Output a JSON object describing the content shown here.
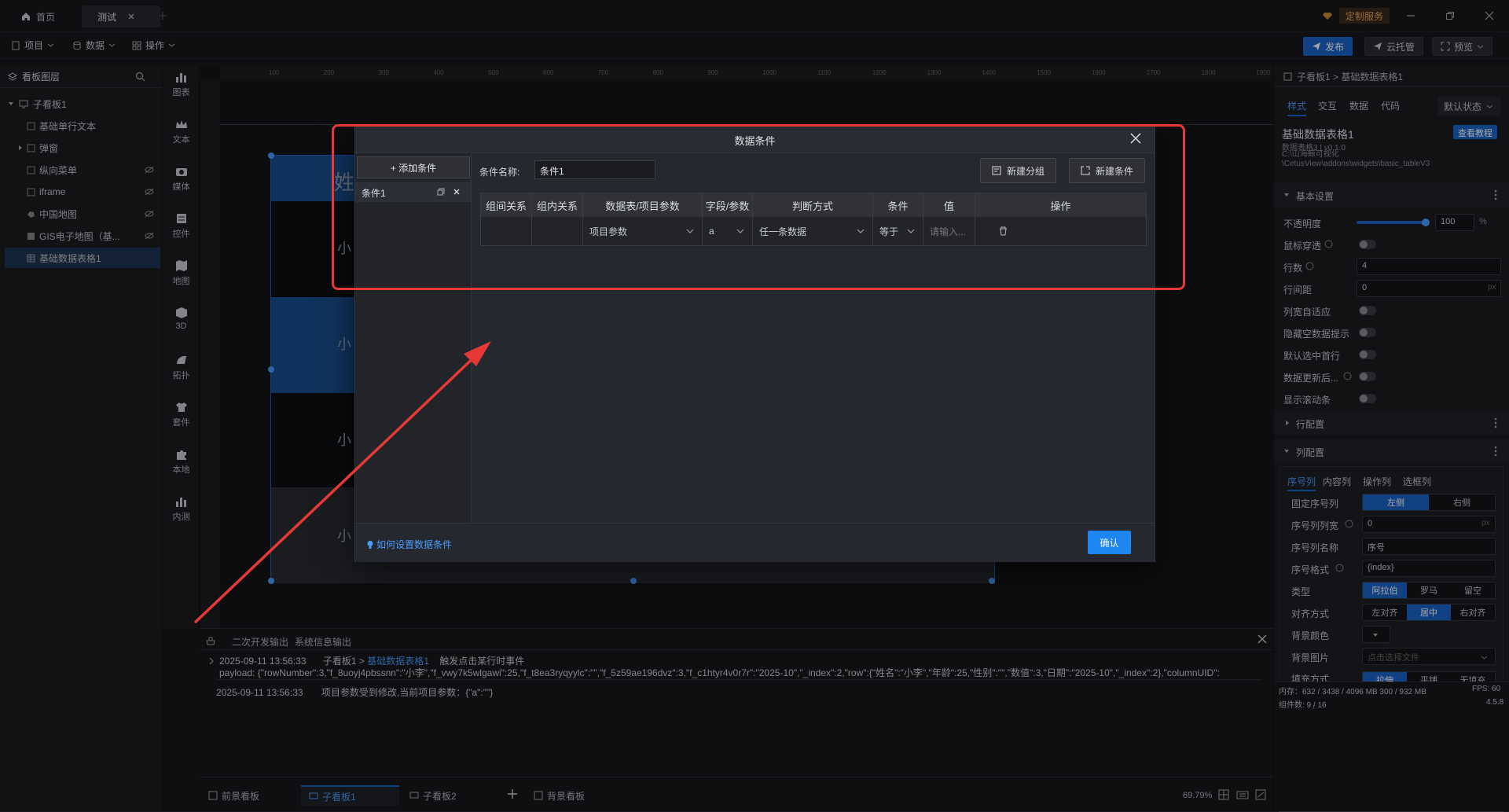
{
  "title_tabs": [
    {
      "label": "首页"
    },
    {
      "label": "测试"
    }
  ],
  "window": {
    "custom_service": "定制服务"
  },
  "menubar": {
    "project": "项目",
    "data": "数据",
    "operation": "操作",
    "publish": "发布",
    "cloud": "云托管",
    "preview": "预览"
  },
  "layers": {
    "header": "看板图层",
    "items": [
      {
        "label": "子看板1"
      },
      {
        "label": "基础单行文本"
      },
      {
        "label": "弹窗"
      },
      {
        "label": "纵向菜单"
      },
      {
        "label": "iframe"
      },
      {
        "label": "中国地图"
      },
      {
        "label": "GIS电子地图（基..."
      },
      {
        "label": "基础数据表格1"
      }
    ]
  },
  "tools": [
    {
      "label": "图表"
    },
    {
      "label": "文本"
    },
    {
      "label": "媒体"
    },
    {
      "label": "控件"
    },
    {
      "label": "地图"
    },
    {
      "label": "3D"
    },
    {
      "label": "拓扑"
    },
    {
      "label": "套件"
    },
    {
      "label": "本地"
    },
    {
      "label": "内测"
    }
  ],
  "ruler": {
    "ticks": [
      "100",
      "200",
      "300",
      "400",
      "500",
      "600",
      "700",
      "800",
      "900",
      "1000",
      "1100",
      "1200",
      "1300",
      "1400",
      "1500",
      "1600",
      "1700",
      "1800",
      "1900"
    ]
  },
  "canvas_table": {
    "cells": [
      "姓",
      "小",
      "小",
      "小",
      "小"
    ]
  },
  "modal": {
    "title": "数据条件",
    "add_condition": "+ 添加条件",
    "condition_item": "条件1",
    "name_label": "条件名称:",
    "name_value": "条件1",
    "new_group": "新建分组",
    "new_condition": "新建条件",
    "columns": [
      "组间关系",
      "组内关系",
      "数据表/项目参数",
      "字段/参数",
      "判断方式",
      "条件",
      "值",
      "操作"
    ],
    "row": {
      "source": "项目参数",
      "field": "a",
      "method": "任一条数据",
      "cond": "等于",
      "value_placeholder": "请输入..."
    },
    "help": "如何设置数据条件",
    "confirm": "确认"
  },
  "console": {
    "tabs": [
      "二次开发输出",
      "系统信息输出"
    ],
    "line1_time": "2025-09-11 13:56:33",
    "line1_path": "子看板1 >",
    "line1_link": "基础数据表格1",
    "line1_event": "触发点击某行时事件",
    "line1_payload": "payload: {\"rowNumber\":3,\"f_8uoyj4pbssnn\":\"小李\",\"f_vwy7k5wlgawi\":25,\"f_t8ea3ryqyylc\":\"\",\"f_5z59ae196dvz\":3,\"f_c1htyr4v0r7r\":\"2025-10\",\"_index\":2,\"row\":{\"姓名\":\"小李\",\"年龄\":25,\"性别\":\"\",\"数值\":3,\"日期\":\"2025-10\",\"_index\":2},\"columnUID\":",
    "line2_time": "2025-09-11 13:56:33",
    "line2_text": "项目参数受到修改,当前项目参数：{\"a\":\"\"}"
  },
  "bottom_tabs": [
    {
      "label": "前景看板"
    },
    {
      "label": "子看板1"
    },
    {
      "label": "子看板2"
    },
    {
      "label": "背景看板"
    }
  ],
  "zoom": "69.79%",
  "right": {
    "breadcrumb": "子看板1 > 基础数据表格1",
    "tabs": [
      "样式",
      "交互",
      "数据",
      "代码"
    ],
    "state": "默认状态",
    "widget_name": "基础数据表格1",
    "widget_ver": "数据表格3 | v0.1.0",
    "widget_path": "C:\\山海鲸可视化\\CetusView\\addons\\widgets\\basic_tableV3",
    "tutorial": "查看教程",
    "basic_section": "基本设置",
    "opacity_label": "不透明度",
    "opacity_value": "100",
    "opacity_unit": "%",
    "mouse_through": "鼠标穿透",
    "rows_label": "行数",
    "rows_value": "4",
    "row_gap_label": "行间距",
    "row_gap_value": "0",
    "px": "px",
    "col_auto": "列宽自适应",
    "hide_empty": "隐藏空数据提示",
    "default_first": "默认选中首行",
    "data_update": "数据更新后...",
    "show_scroll": "显示滚动条",
    "row_config": "行配置",
    "col_config": "列配置",
    "col_tabs": [
      "序号列",
      "内容列",
      "操作列",
      "选框列"
    ],
    "fixed_seq": "固定序号列",
    "left": "左侧",
    "right_side": "右侧",
    "seq_width": "序号列列宽",
    "seq_width_value": "0",
    "seq_name": "序号列名称",
    "seq_name_value": "序号",
    "seq_format": "序号格式",
    "seq_format_value": "{index}",
    "type_label": "类型",
    "types": [
      "阿拉伯",
      "罗马",
      "留空"
    ],
    "align_label": "对齐方式",
    "aligns": [
      "左对齐",
      "居中",
      "右对齐"
    ],
    "bg_color": "背景颜色",
    "bg_image": "背景图片",
    "bg_image_placeholder": "点击选择文件",
    "fill_mode": "填充方式",
    "fills": [
      "拉伸",
      "平铺",
      "无填充"
    ],
    "stats": "内存：632 / 3438 / 4096 MB  300 / 932 MB",
    "fps": "FPS: 60",
    "components": "组件数: 9 / 16",
    "version": "4.5.8"
  }
}
